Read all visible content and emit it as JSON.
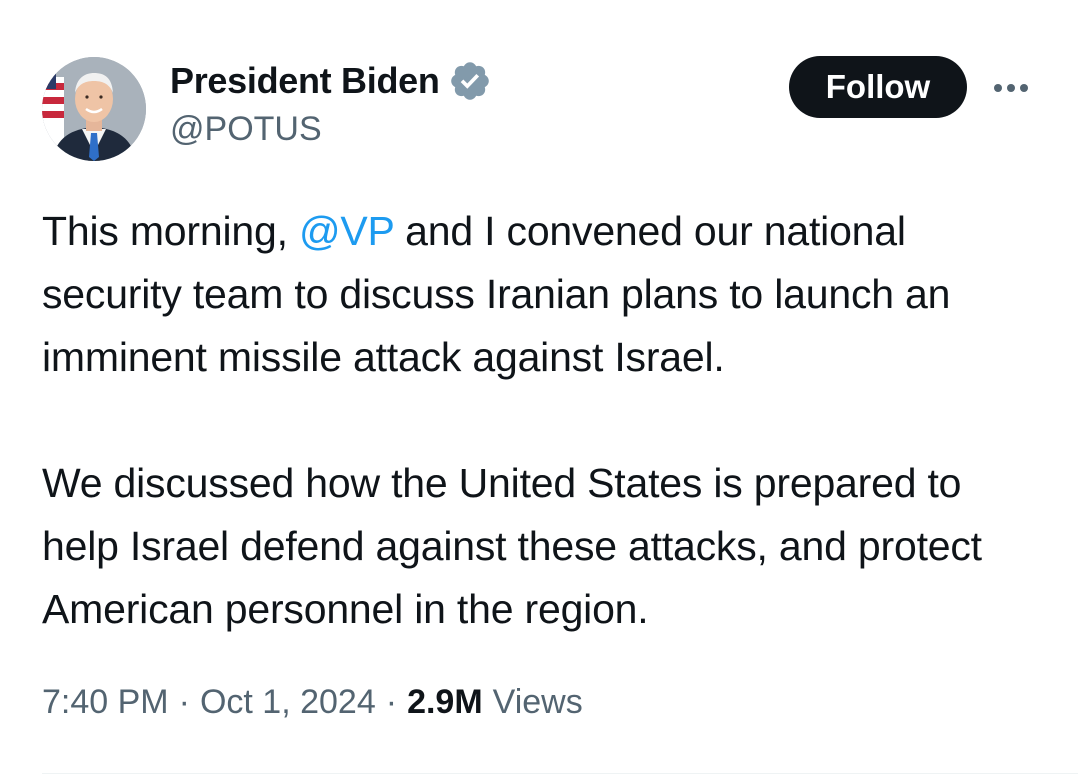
{
  "author": {
    "display_name": "President Biden",
    "handle": "@POTUS",
    "verified": true,
    "verified_color": "#829aab",
    "avatar_icon": "avatar-photo"
  },
  "actions": {
    "follow_label": "Follow",
    "more_icon": "more-horizontal-icon"
  },
  "tweet": {
    "paragraph1": {
      "before": "This morning, ",
      "mention": "@VP",
      "after": " and I convened our national security team to discuss Iranian plans to launch an imminent missile attack against Israel."
    },
    "paragraph2": "We discussed how the United States is prepared to help Israel defend against these attacks, and protect American personnel in the region."
  },
  "meta": {
    "time": "7:40 PM",
    "separator": "·",
    "date": "Oct 1, 2024",
    "views_count": "2.9M",
    "views_label": "Views"
  },
  "colors": {
    "text": "#0f1419",
    "secondary": "#536471",
    "link": "#1d9bf0",
    "button_bg": "#0f1419"
  }
}
